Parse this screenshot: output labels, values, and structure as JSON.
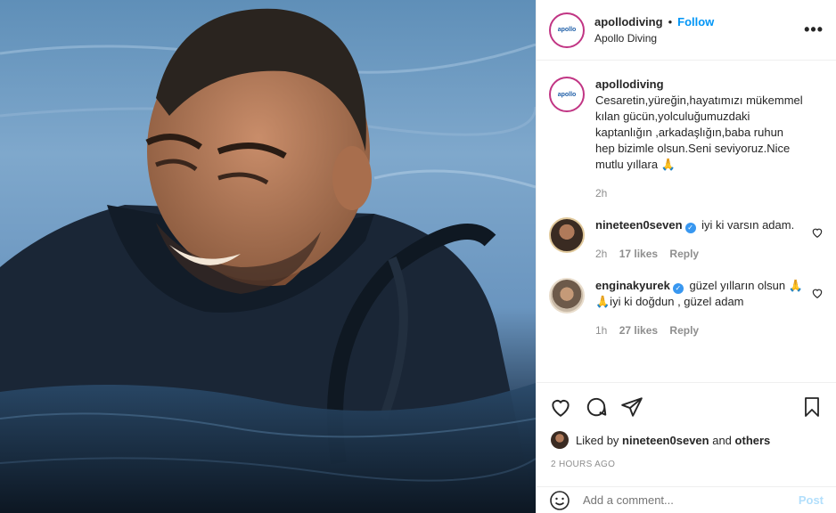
{
  "post": {
    "username": "apollodiving",
    "dot": "•",
    "follow_label": "Follow",
    "subtitle": "Apollo Diving",
    "more_label": "•••",
    "avatar_text": "apollo"
  },
  "caption": {
    "username": "apollodiving",
    "text": "Cesaretin,yüreğin,hayatımızı mükemmel kılan gücün,yolculuğumuzdaki kaptanlığın ,arkadaşlığın,baba ruhun hep bizimle olsun.Seni seviyoruz.Nice mutlu yıllara 🙏",
    "time": "2h"
  },
  "comments": [
    {
      "username": "nineteen0seven",
      "verified_mark": "✓",
      "text": "iyi ki varsın adam.",
      "time": "2h",
      "likes": "17 likes",
      "reply": "Reply"
    },
    {
      "username": "enginakyurek",
      "verified_mark": "✓",
      "text": "güzel yılların olsun 🙏🙏iyi ki doğdun , güzel adam",
      "time": "1h",
      "likes": "27 likes",
      "reply": "Reply"
    }
  ],
  "likes_line": {
    "prefix": "Liked by",
    "user": "nineteen0seven",
    "and": "and",
    "others": "others"
  },
  "timestamp": "2 HOURS AGO",
  "add_comment": {
    "placeholder": "Add a comment...",
    "post_label": "Post"
  },
  "colors": {
    "accent": "#0095f6",
    "verified": "#3897f0",
    "muted": "#8e8e8e",
    "post_disabled": "#b2dffc"
  },
  "icons": [
    "more-icon",
    "heart-icon",
    "comment-icon",
    "share-icon",
    "bookmark-icon",
    "emoji-icon",
    "verified-icon"
  ]
}
